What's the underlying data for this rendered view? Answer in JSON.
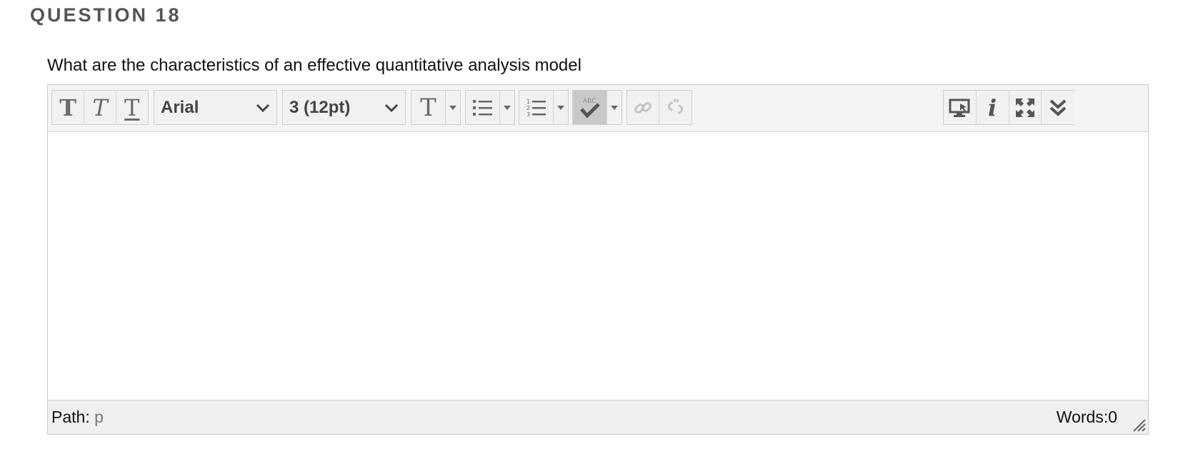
{
  "question": {
    "heading": "QUESTION 18",
    "text": "What are the characteristics of an effective quantitative analysis model"
  },
  "toolbar": {
    "font_family": "Arial",
    "font_size": "3 (12pt)",
    "buttons": [
      {
        "name": "bold",
        "icon": "bold-icon"
      },
      {
        "name": "italic",
        "icon": "italic-icon"
      },
      {
        "name": "underline",
        "icon": "underline-icon"
      },
      {
        "name": "text-color",
        "icon": "text-color-icon"
      },
      {
        "name": "bullet-list",
        "icon": "bullet-list-icon"
      },
      {
        "name": "numbered-list",
        "icon": "numbered-list-icon"
      },
      {
        "name": "spellcheck",
        "icon": "spellcheck-icon",
        "active": true
      },
      {
        "name": "link",
        "icon": "link-icon",
        "disabled": true
      },
      {
        "name": "unlink",
        "icon": "unlink-icon",
        "disabled": true
      },
      {
        "name": "preview",
        "icon": "preview-icon"
      },
      {
        "name": "info",
        "icon": "info-icon"
      },
      {
        "name": "fullscreen",
        "icon": "fullscreen-icon"
      },
      {
        "name": "expand-toolbar",
        "icon": "double-chevron-down-icon"
      }
    ],
    "spell_icon_text": "ABC"
  },
  "editor": {
    "content": ""
  },
  "status": {
    "path_label": "Path:",
    "path_value": "p",
    "words_label": "Words:0"
  },
  "colors": {
    "toolbar_bg": "#f4f4f4",
    "statusbar_bg": "#efefef",
    "border": "#c9c9c9",
    "heading": "#555555",
    "spell_active": "#c9c9c9"
  }
}
